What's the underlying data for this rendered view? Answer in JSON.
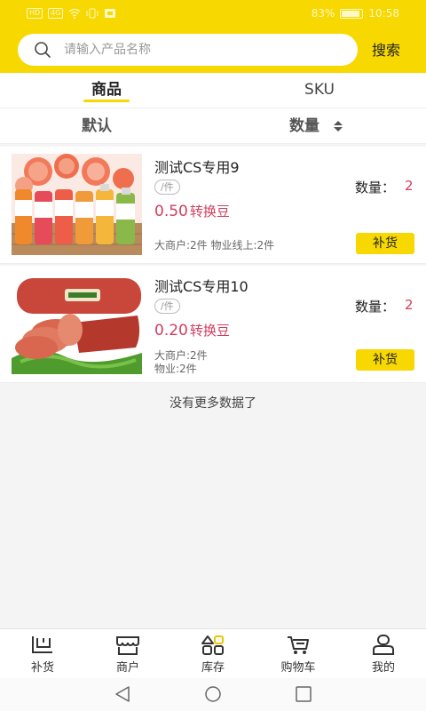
{
  "status_bar": {
    "left_icons": [
      "HD",
      "4G"
    ],
    "battery_percent": "83%",
    "time": "10:58"
  },
  "search": {
    "placeholder": "请输入产品名称",
    "value": "",
    "button_label": "搜索"
  },
  "tabs": [
    {
      "label": "商品",
      "active": true
    },
    {
      "label": "SKU",
      "active": false
    }
  ],
  "sort": {
    "default_label": "默认",
    "quantity_label": "数量"
  },
  "products": [
    {
      "name": "测试CS专用9",
      "unit": "/件",
      "qty_label": "数量：",
      "qty_value": "2",
      "price": "0.50",
      "price_unit": "转换豆",
      "meta": [
        "大商户:2件  物业线上:2件"
      ],
      "restock_label": "补货",
      "image": "juice-bottles-grapefruit"
    },
    {
      "name": "测试CS专用10",
      "unit": "/件",
      "qty_label": "数量：",
      "qty_value": "2",
      "price": "0.20",
      "price_unit": "转换豆",
      "meta": [
        "大商户:2件",
        "物业:2件"
      ],
      "restock_label": "补货",
      "image": "sausage-ham-slices"
    }
  ],
  "no_more_text": "没有更多数据了",
  "bottom_nav": [
    {
      "label": "补货",
      "icon": "restock-icon",
      "active": false
    },
    {
      "label": "商户",
      "icon": "merchant-icon",
      "active": false
    },
    {
      "label": "库存",
      "icon": "inventory-icon",
      "active": true
    },
    {
      "label": "购物车",
      "icon": "cart-icon",
      "active": false
    },
    {
      "label": "我的",
      "icon": "profile-icon",
      "active": false
    }
  ],
  "colors": {
    "brand_yellow": "#f7d800",
    "price_red": "#d23d5f"
  }
}
